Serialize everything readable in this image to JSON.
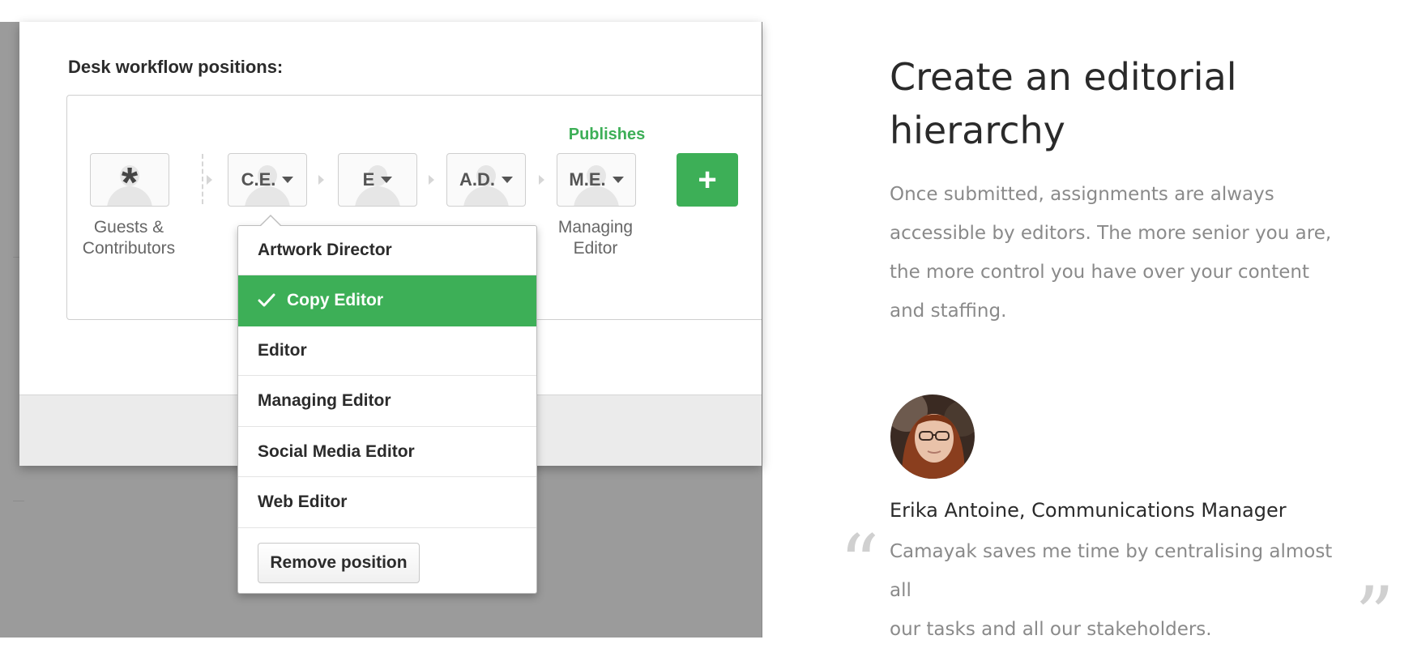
{
  "workflow": {
    "title": "Desk workflow positions:",
    "publishes_label": "Publishes",
    "add_label": "+",
    "positions": [
      {
        "abbr": "*",
        "label_line1": "Guests &",
        "label_line2": "Contributors"
      },
      {
        "abbr": "C.E.",
        "label_line1": "",
        "label_line2": ""
      },
      {
        "abbr": "E",
        "label_line1": "",
        "label_line2": ""
      },
      {
        "abbr": "A.D.",
        "label_line1": "",
        "label_line2": ""
      },
      {
        "abbr": "M.E.",
        "label_line1": "Managing",
        "label_line2": "Editor"
      }
    ]
  },
  "dropdown": {
    "items": [
      {
        "label": "Artwork Director",
        "selected": false
      },
      {
        "label": "Copy Editor",
        "selected": true
      },
      {
        "label": "Editor",
        "selected": false
      },
      {
        "label": "Managing Editor",
        "selected": false
      },
      {
        "label": "Social Media Editor",
        "selected": false
      },
      {
        "label": "Web Editor",
        "selected": false
      }
    ],
    "remove_label": "Remove position"
  },
  "marketing": {
    "headline_line1": "Create an editorial",
    "headline_line2": "hierarchy",
    "body_lines": [
      "Once submitted, assignments are always",
      "accessible by editors. The more senior you are,",
      "the more control you have over your content",
      "and staffing."
    ],
    "author": "Erika Antoine, Communications Manager",
    "quote_lines": [
      "Camayak saves me time by centralising almost all",
      "our tasks and all our stakeholders."
    ],
    "open_quote": "“",
    "close_quote": "”"
  },
  "colors": {
    "accent_green": "#3daf57",
    "overlay_gray": "#9b9b9b"
  },
  "icons": {
    "check": "check-icon",
    "caret": "caret-down-icon",
    "person": "person-silhouette-icon",
    "plus": "plus-icon"
  }
}
